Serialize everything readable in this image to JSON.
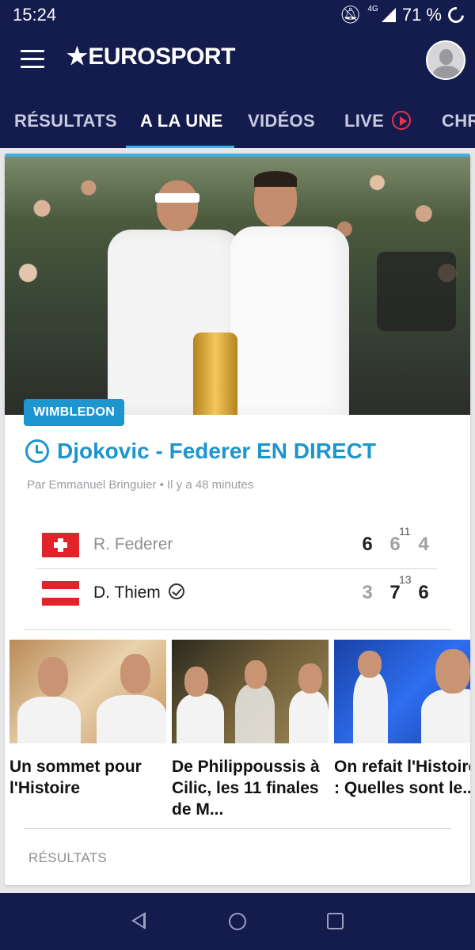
{
  "status_bar": {
    "time": "15:24",
    "network": "4G",
    "battery": "71 %"
  },
  "header": {
    "logo_text": "EUROSPORT"
  },
  "tabs": [
    {
      "label": "RÉSULTATS"
    },
    {
      "label": "A LA UNE"
    },
    {
      "label": "VIDÉOS"
    },
    {
      "label": "LIVE"
    },
    {
      "label": "CHR"
    }
  ],
  "article": {
    "badge": "WIMBLEDON",
    "title": "Djokovic - Federer EN DIRECT",
    "byline": "Par Emmanuel Bringuier • Il y a 48 minutes"
  },
  "score": {
    "rows": [
      {
        "player": "R. Federer",
        "sets": [
          "6",
          "6",
          "4"
        ],
        "tiebreak": "11"
      },
      {
        "player": "D. Thiem",
        "sets": [
          "3",
          "7",
          "6"
        ],
        "tiebreak": "13"
      }
    ]
  },
  "related": [
    {
      "title": "Un sommet pour l'Histoire"
    },
    {
      "title": "De Philippoussis à Cilic, les 11 finales de M..."
    },
    {
      "title": "On refait l'Histoire : Quelles sont le..."
    }
  ],
  "section_label": "RÉSULTATS",
  "colors": {
    "brand_navy": "#141b4d",
    "accent_blue": "#1d95cf",
    "live_red": "#e8334a"
  }
}
